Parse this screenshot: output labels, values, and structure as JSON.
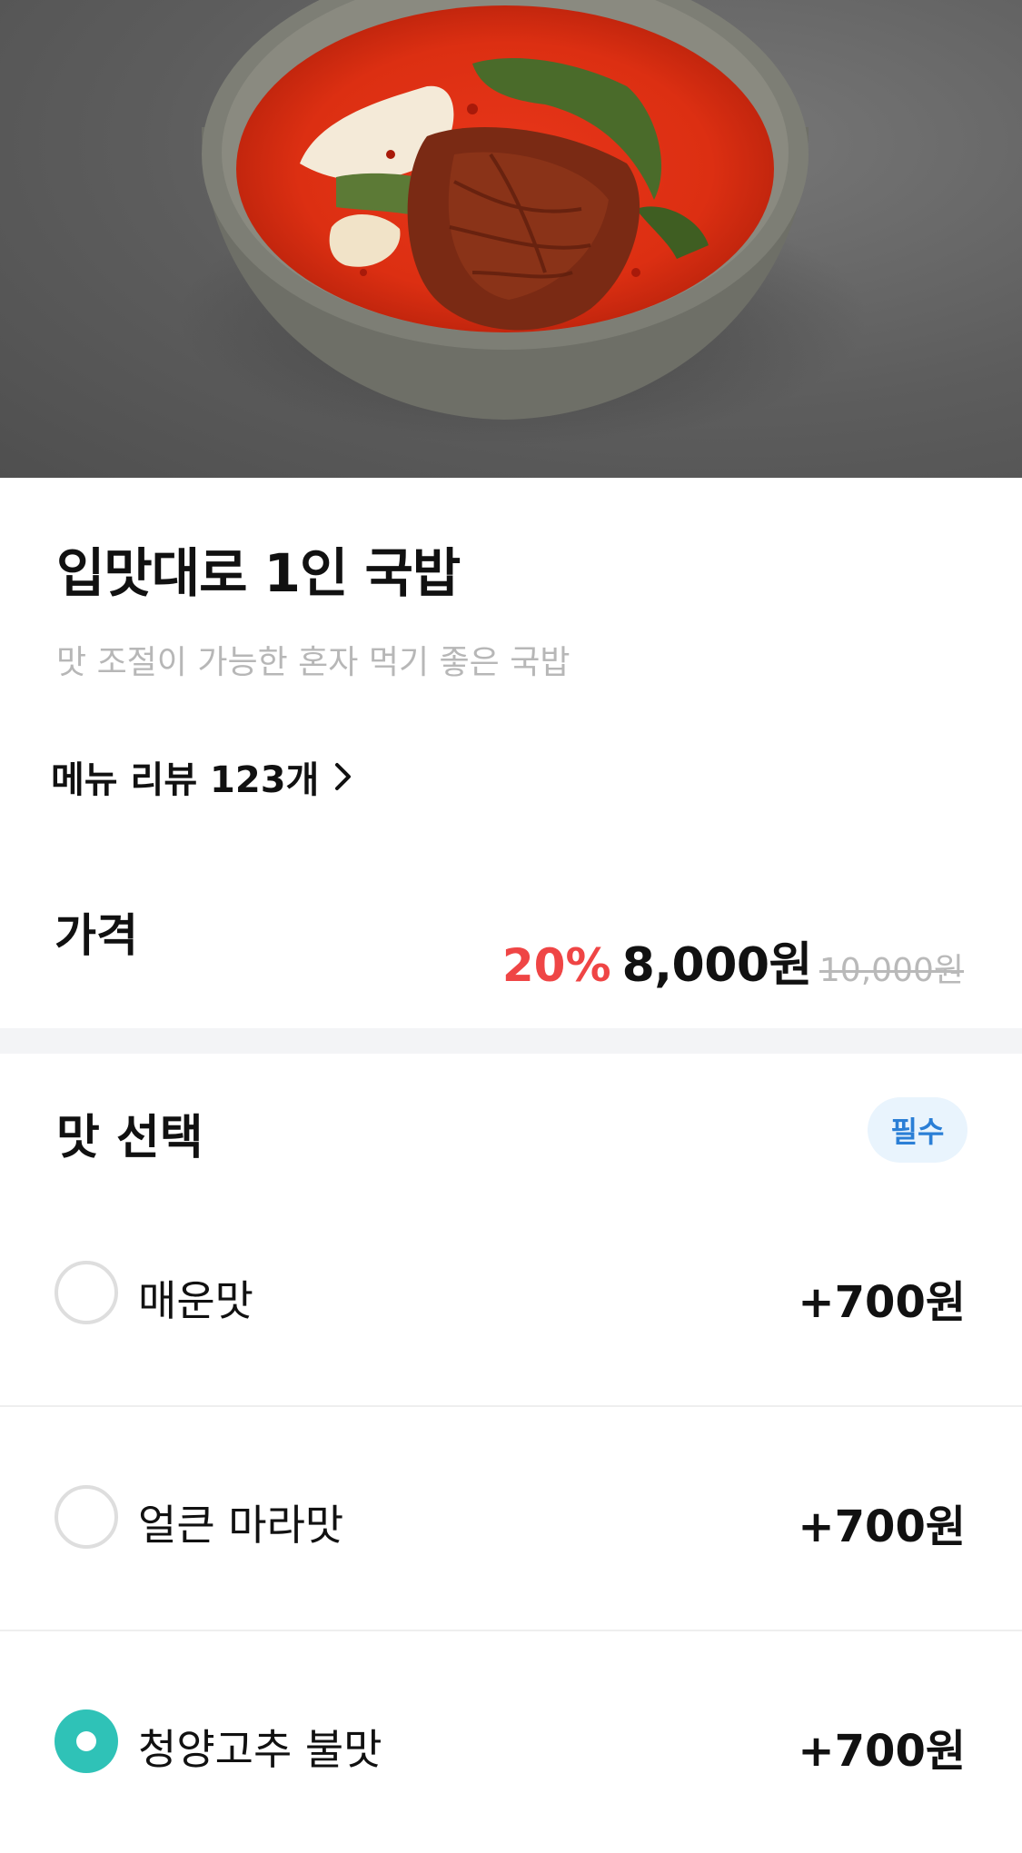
{
  "product": {
    "title": "입맛대로 1인 국밥",
    "description": "맛 조절이 가능한 혼자 먹기 좋은 국밥",
    "review_link": "메뉴 리뷰 123개"
  },
  "price": {
    "label": "가격",
    "discount": "20%",
    "current": "8,000원",
    "original": "10,000원"
  },
  "options": {
    "title": "맛 선택",
    "badge": "필수",
    "items": [
      {
        "label": "매운맛",
        "price": "+700원",
        "selected": false
      },
      {
        "label": "얼큰 마라맛",
        "price": "+700원",
        "selected": false
      },
      {
        "label": "청양고추 불맛",
        "price": "+700원",
        "selected": true
      }
    ]
  },
  "colors": {
    "accent_red": "#ef4545",
    "selected_teal": "#2fc2b7",
    "badge_blue": "#2b7fd6",
    "badge_bg": "#e9f4fd"
  },
  "icons": {
    "review_chevron": "chevron-right-icon"
  }
}
